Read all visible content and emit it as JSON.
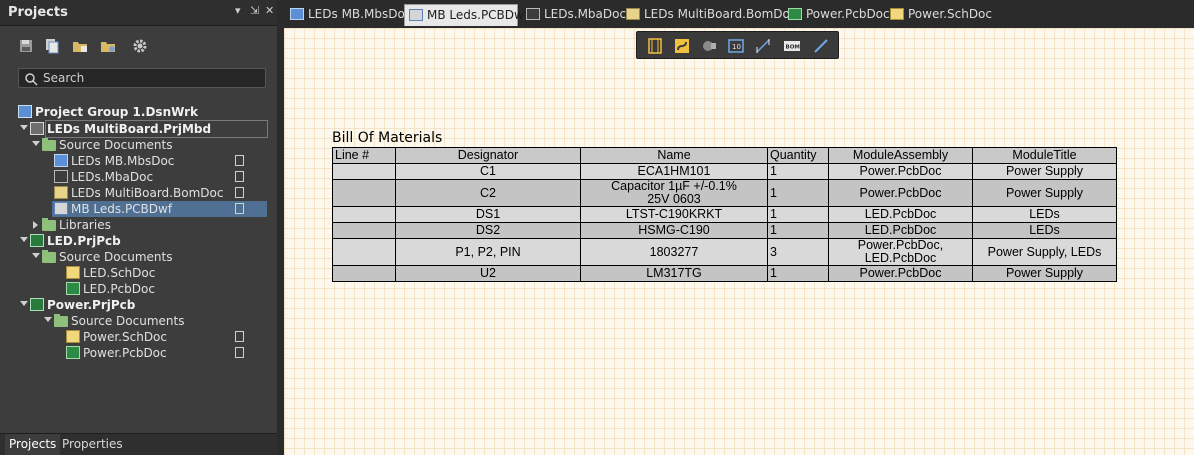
{
  "panel": {
    "title": "Projects",
    "header_controls": [
      "▾",
      "⇲",
      "✕"
    ],
    "search_placeholder": "Search",
    "bottom_tabs": [
      "Projects",
      "Properties"
    ]
  },
  "tree": [
    {
      "label": "Project Group 1.DsnWrk",
      "icon": "design-workspace-icon",
      "level": 0,
      "bold": true
    },
    {
      "label": "LEDs MultiBoard.PrjMbd",
      "icon": "multiboard-project-icon",
      "level": 1,
      "bold": true,
      "expanded": true,
      "focused": true
    },
    {
      "label": "Source Documents",
      "icon": "folder-icon",
      "level": 2,
      "expanded": true
    },
    {
      "label": "LEDs MB.MbsDoc",
      "icon": "multiboard-schematic-icon",
      "level": 3,
      "doc": true
    },
    {
      "label": "LEDs.MbaDoc",
      "icon": "multiboard-assembly-icon",
      "level": 3,
      "doc": true
    },
    {
      "label": "LEDs MultiBoard.BomDoc",
      "icon": "bom-document-icon",
      "level": 3,
      "doc": true
    },
    {
      "label": "MB Leds.PCBDwf",
      "icon": "draftsman-document-icon",
      "level": 3,
      "doc": true,
      "selected": true
    },
    {
      "label": "Libraries",
      "icon": "folder-icon",
      "level": 2,
      "expanded": false
    },
    {
      "label": "LED.PrjPcb",
      "icon": "pcb-project-icon",
      "level": 1,
      "bold": true,
      "expanded": true
    },
    {
      "label": "Source Documents",
      "icon": "folder-icon",
      "level": 2,
      "expanded": true
    },
    {
      "label": "LED.SchDoc",
      "icon": "schematic-document-icon",
      "level": 3
    },
    {
      "label": "LED.PcbDoc",
      "icon": "pcb-document-icon",
      "level": 3
    },
    {
      "label": "Power.PrjPcb",
      "icon": "pcb-project-icon",
      "level": 1,
      "bold": true,
      "expanded": true
    },
    {
      "label": "Source Documents",
      "icon": "folder-icon",
      "level": 2,
      "expanded": true
    },
    {
      "label": "Power.SchDoc",
      "icon": "schematic-document-icon",
      "level": 3,
      "doc": true
    },
    {
      "label": "Power.PcbDoc",
      "icon": "pcb-document-icon",
      "level": 3,
      "doc": true
    }
  ],
  "doc_tabs": [
    {
      "label": "LEDs MB.MbsDoc",
      "icon": "multiboard-schematic-icon"
    },
    {
      "label": "MB Leds.PCBDwf",
      "icon": "draftsman-document-icon",
      "active": true
    },
    {
      "label": "LEDs.MbaDoc",
      "icon": "multiboard-assembly-icon"
    },
    {
      "label": "LEDs MultiBoard.BomDoc",
      "icon": "bom-document-icon"
    },
    {
      "label": "Power.PcbDoc",
      "icon": "pcb-document-icon"
    },
    {
      "label": "Power.SchDoc",
      "icon": "schematic-document-icon"
    }
  ],
  "floating_toolbar": [
    "board-assembly-view-icon",
    "wire-harness-icon",
    "component-view-icon",
    "title-block-icon",
    "dimension-icon",
    "bom-icon",
    "line-icon"
  ],
  "bom": {
    "title": "Bill Of Materials",
    "headers": [
      "Line #",
      "Designator",
      "Name",
      "Quantity",
      "ModuleAssembly",
      "ModuleTitle"
    ],
    "rows": [
      [
        "",
        "C1",
        "ECA1HM101",
        "1",
        "Power.PcbDoc",
        "Power Supply"
      ],
      [
        "",
        "C2",
        "Capacitor 1µF +/-0.1% 25V 0603",
        "1",
        "Power.PcbDoc",
        "Power Supply"
      ],
      [
        "",
        "DS1",
        "LTST-C190KRKT",
        "1",
        "LED.PcbDoc",
        "LEDs"
      ],
      [
        "",
        "DS2",
        "HSMG-C190",
        "1",
        "LED.PcbDoc",
        "LEDs"
      ],
      [
        "",
        "P1, P2, PIN",
        "1803277",
        "3",
        "Power.PcbDoc, LED.PcbDoc",
        "Power Supply, LEDs"
      ],
      [
        "",
        "U2",
        "LM317TG",
        "1",
        "Power.PcbDoc",
        "Power Supply"
      ]
    ]
  }
}
